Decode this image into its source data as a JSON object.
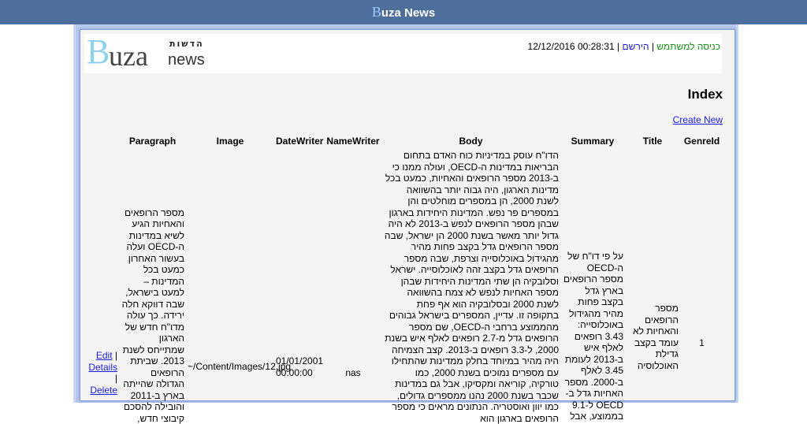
{
  "topbar": {
    "title_first": "B",
    "title_rest": "uza News"
  },
  "logo": {
    "big_letter": "B",
    "uza": "uza",
    "hebrew": "הדשות",
    "news": "news"
  },
  "login": {
    "register": "הירשם",
    "separator1": " | ",
    "login": "כניסה למשתמש",
    "separator2": " | ",
    "datetime": "12/12/2016 00:28:31"
  },
  "page": {
    "heading": "Index",
    "create_new": "Create New"
  },
  "table": {
    "headers": {
      "actions": "",
      "paragraph": "Paragraph",
      "image": "Image",
      "datewriter": "DateWriter",
      "namewriter": "NameWriter",
      "body": "Body",
      "summary": "Summary",
      "title": "Title",
      "genreid": "GenreId"
    },
    "rows": [
      {
        "edit": "Edit",
        "sep": "|",
        "details": "Details",
        "sep2": "|",
        "delete": "Delete",
        "paragraph": "מספר הרופאים והאחיות הגיע לשיא במדינות ה-OECD ועלה בעשור האחרון כמעט בכל המדינות – למעט בישראל, שבה דווקא חלה ירידה. כך עולה מדו\"ח חדש של הארגון שמתייחס לשנת 2013. שביתת הרופאים הגדולה שהייתה בארץ ב-2011 והובילה להסכם קיבוצי חדש,",
        "image": "~/Content/Images/12.jpg",
        "datewriter": "01/01/2001 00:00:00",
        "namewriter": "nas",
        "body": "הדו\"ח עוסק במדיניות כוח האדם בתחום הבריאות במדינות ה-OECD, ועולה ממנו כי ב-2013 מספר הרופאים והאחיות, כמעט בכל מדינות הארגון, היה גבוה יותר בהשוואה לשנת 2000, הן במספרים מוחלטים והן במספרים פר נפש. המדינות היחידות בארגון שבהן מספר הרופאים לנפש ב-2013 לא היה גדול יותר מאשר בשנת 2000 הן ישראל, שבה מספר הרופאים גדל בקצב פחות מהיר מהגידול באוכלוסייה וצרפת, שבה מספר הרופאים גדל בקצב זהה לאוכלוסייה. ישראל וסלובקיה הן שתי המדינות היחידות שבהן מספר האחיות לנפש לא צמח בהשוואה לשנת 2000 ובסלובקיה הוא אף פחת בתקופה זו. עדיין, המספרים בישראל גבוהים מהממוצע ברחבי ה-OECD, שם מספר הרופאים גדל מ-2.7 רופאים לאלף איש בשנת 2000, ל-3.3 רופאים ב-2013. קצב הצמיחה היה מהיר במיוחד בחלק ממדינות שהתחילו עם מספרים נמוכים בשנת 2000, כמו טורקיה, קוריאה ומקסיקו, אבל גם במדינות שכבר בשנת 2000 נהנו ממספרים גדולים, כמו יוון ואוסטריה. הנתונים מראים כי מספר הרופאים בארגון הוא",
        "summary": "על פי דו\"ח של ה-OECD מספר הרופאים בארץ גדל בקצב פחות מהיר מהגידול באוכלוסייה: 3.43 רופאים לאלף איש ב-2013 לעומת 3.45 לאלף ב-2000. מספר האחיות גדל ב-OECD ל-9.1 בממוצע, אבל",
        "title": "מספר הרופאים והאחיות לא עומד בקצב גדילת האוכלוסיה",
        "genreid": "1"
      }
    ]
  }
}
